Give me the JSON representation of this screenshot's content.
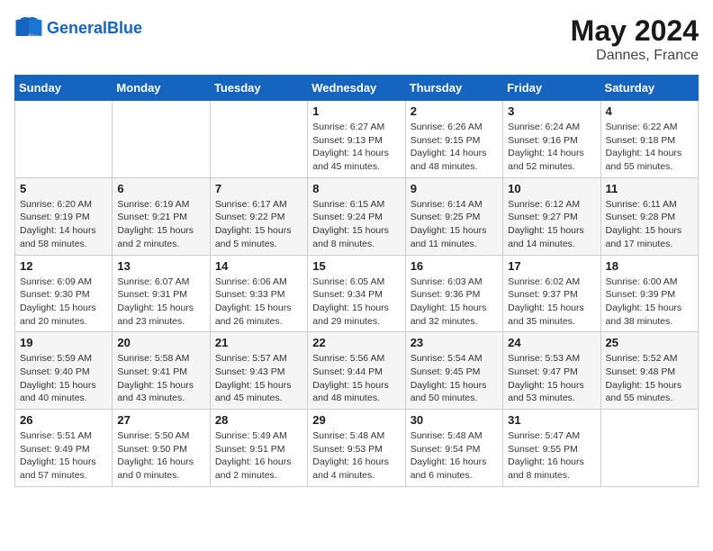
{
  "header": {
    "logo_general": "General",
    "logo_blue": "Blue",
    "month": "May 2024",
    "location": "Dannes, France"
  },
  "weekdays": [
    "Sunday",
    "Monday",
    "Tuesday",
    "Wednesday",
    "Thursday",
    "Friday",
    "Saturday"
  ],
  "weeks": [
    [
      {
        "day": "",
        "info": ""
      },
      {
        "day": "",
        "info": ""
      },
      {
        "day": "",
        "info": ""
      },
      {
        "day": "1",
        "info": "Sunrise: 6:27 AM\nSunset: 9:13 PM\nDaylight: 14 hours\nand 45 minutes."
      },
      {
        "day": "2",
        "info": "Sunrise: 6:26 AM\nSunset: 9:15 PM\nDaylight: 14 hours\nand 48 minutes."
      },
      {
        "day": "3",
        "info": "Sunrise: 6:24 AM\nSunset: 9:16 PM\nDaylight: 14 hours\nand 52 minutes."
      },
      {
        "day": "4",
        "info": "Sunrise: 6:22 AM\nSunset: 9:18 PM\nDaylight: 14 hours\nand 55 minutes."
      }
    ],
    [
      {
        "day": "5",
        "info": "Sunrise: 6:20 AM\nSunset: 9:19 PM\nDaylight: 14 hours\nand 58 minutes."
      },
      {
        "day": "6",
        "info": "Sunrise: 6:19 AM\nSunset: 9:21 PM\nDaylight: 15 hours\nand 2 minutes."
      },
      {
        "day": "7",
        "info": "Sunrise: 6:17 AM\nSunset: 9:22 PM\nDaylight: 15 hours\nand 5 minutes."
      },
      {
        "day": "8",
        "info": "Sunrise: 6:15 AM\nSunset: 9:24 PM\nDaylight: 15 hours\nand 8 minutes."
      },
      {
        "day": "9",
        "info": "Sunrise: 6:14 AM\nSunset: 9:25 PM\nDaylight: 15 hours\nand 11 minutes."
      },
      {
        "day": "10",
        "info": "Sunrise: 6:12 AM\nSunset: 9:27 PM\nDaylight: 15 hours\nand 14 minutes."
      },
      {
        "day": "11",
        "info": "Sunrise: 6:11 AM\nSunset: 9:28 PM\nDaylight: 15 hours\nand 17 minutes."
      }
    ],
    [
      {
        "day": "12",
        "info": "Sunrise: 6:09 AM\nSunset: 9:30 PM\nDaylight: 15 hours\nand 20 minutes."
      },
      {
        "day": "13",
        "info": "Sunrise: 6:07 AM\nSunset: 9:31 PM\nDaylight: 15 hours\nand 23 minutes."
      },
      {
        "day": "14",
        "info": "Sunrise: 6:06 AM\nSunset: 9:33 PM\nDaylight: 15 hours\nand 26 minutes."
      },
      {
        "day": "15",
        "info": "Sunrise: 6:05 AM\nSunset: 9:34 PM\nDaylight: 15 hours\nand 29 minutes."
      },
      {
        "day": "16",
        "info": "Sunrise: 6:03 AM\nSunset: 9:36 PM\nDaylight: 15 hours\nand 32 minutes."
      },
      {
        "day": "17",
        "info": "Sunrise: 6:02 AM\nSunset: 9:37 PM\nDaylight: 15 hours\nand 35 minutes."
      },
      {
        "day": "18",
        "info": "Sunrise: 6:00 AM\nSunset: 9:39 PM\nDaylight: 15 hours\nand 38 minutes."
      }
    ],
    [
      {
        "day": "19",
        "info": "Sunrise: 5:59 AM\nSunset: 9:40 PM\nDaylight: 15 hours\nand 40 minutes."
      },
      {
        "day": "20",
        "info": "Sunrise: 5:58 AM\nSunset: 9:41 PM\nDaylight: 15 hours\nand 43 minutes."
      },
      {
        "day": "21",
        "info": "Sunrise: 5:57 AM\nSunset: 9:43 PM\nDaylight: 15 hours\nand 45 minutes."
      },
      {
        "day": "22",
        "info": "Sunrise: 5:56 AM\nSunset: 9:44 PM\nDaylight: 15 hours\nand 48 minutes."
      },
      {
        "day": "23",
        "info": "Sunrise: 5:54 AM\nSunset: 9:45 PM\nDaylight: 15 hours\nand 50 minutes."
      },
      {
        "day": "24",
        "info": "Sunrise: 5:53 AM\nSunset: 9:47 PM\nDaylight: 15 hours\nand 53 minutes."
      },
      {
        "day": "25",
        "info": "Sunrise: 5:52 AM\nSunset: 9:48 PM\nDaylight: 15 hours\nand 55 minutes."
      }
    ],
    [
      {
        "day": "26",
        "info": "Sunrise: 5:51 AM\nSunset: 9:49 PM\nDaylight: 15 hours\nand 57 minutes."
      },
      {
        "day": "27",
        "info": "Sunrise: 5:50 AM\nSunset: 9:50 PM\nDaylight: 16 hours\nand 0 minutes."
      },
      {
        "day": "28",
        "info": "Sunrise: 5:49 AM\nSunset: 9:51 PM\nDaylight: 16 hours\nand 2 minutes."
      },
      {
        "day": "29",
        "info": "Sunrise: 5:48 AM\nSunset: 9:53 PM\nDaylight: 16 hours\nand 4 minutes."
      },
      {
        "day": "30",
        "info": "Sunrise: 5:48 AM\nSunset: 9:54 PM\nDaylight: 16 hours\nand 6 minutes."
      },
      {
        "day": "31",
        "info": "Sunrise: 5:47 AM\nSunset: 9:55 PM\nDaylight: 16 hours\nand 8 minutes."
      },
      {
        "day": "",
        "info": ""
      }
    ]
  ]
}
